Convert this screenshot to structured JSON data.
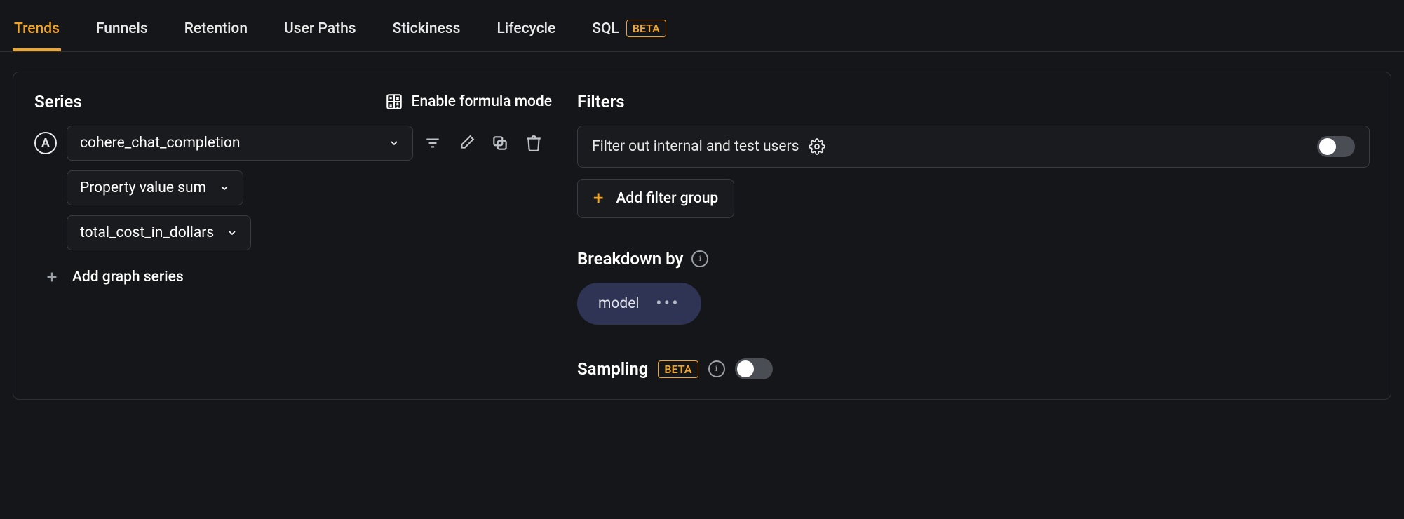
{
  "tabs": {
    "items": [
      {
        "label": "Trends",
        "active": true
      },
      {
        "label": "Funnels"
      },
      {
        "label": "Retention"
      },
      {
        "label": "User Paths"
      },
      {
        "label": "Stickiness"
      },
      {
        "label": "Lifecycle"
      },
      {
        "label": "SQL",
        "beta": true
      }
    ],
    "beta_label": "BETA"
  },
  "series": {
    "title": "Series",
    "formula_label": "Enable formula mode",
    "items": [
      {
        "letter": "A",
        "event": "cohere_chat_completion",
        "aggregation": "Property value sum",
        "property": "total_cost_in_dollars"
      }
    ],
    "add_label": "Add graph series"
  },
  "filters": {
    "title": "Filters",
    "internal_filter_label": "Filter out internal and test users",
    "internal_filter_enabled": false,
    "add_group_label": "Add filter group"
  },
  "breakdown": {
    "title": "Breakdown by",
    "items": [
      {
        "label": "model"
      }
    ]
  },
  "sampling": {
    "title": "Sampling",
    "beta_label": "BETA",
    "enabled": false
  }
}
